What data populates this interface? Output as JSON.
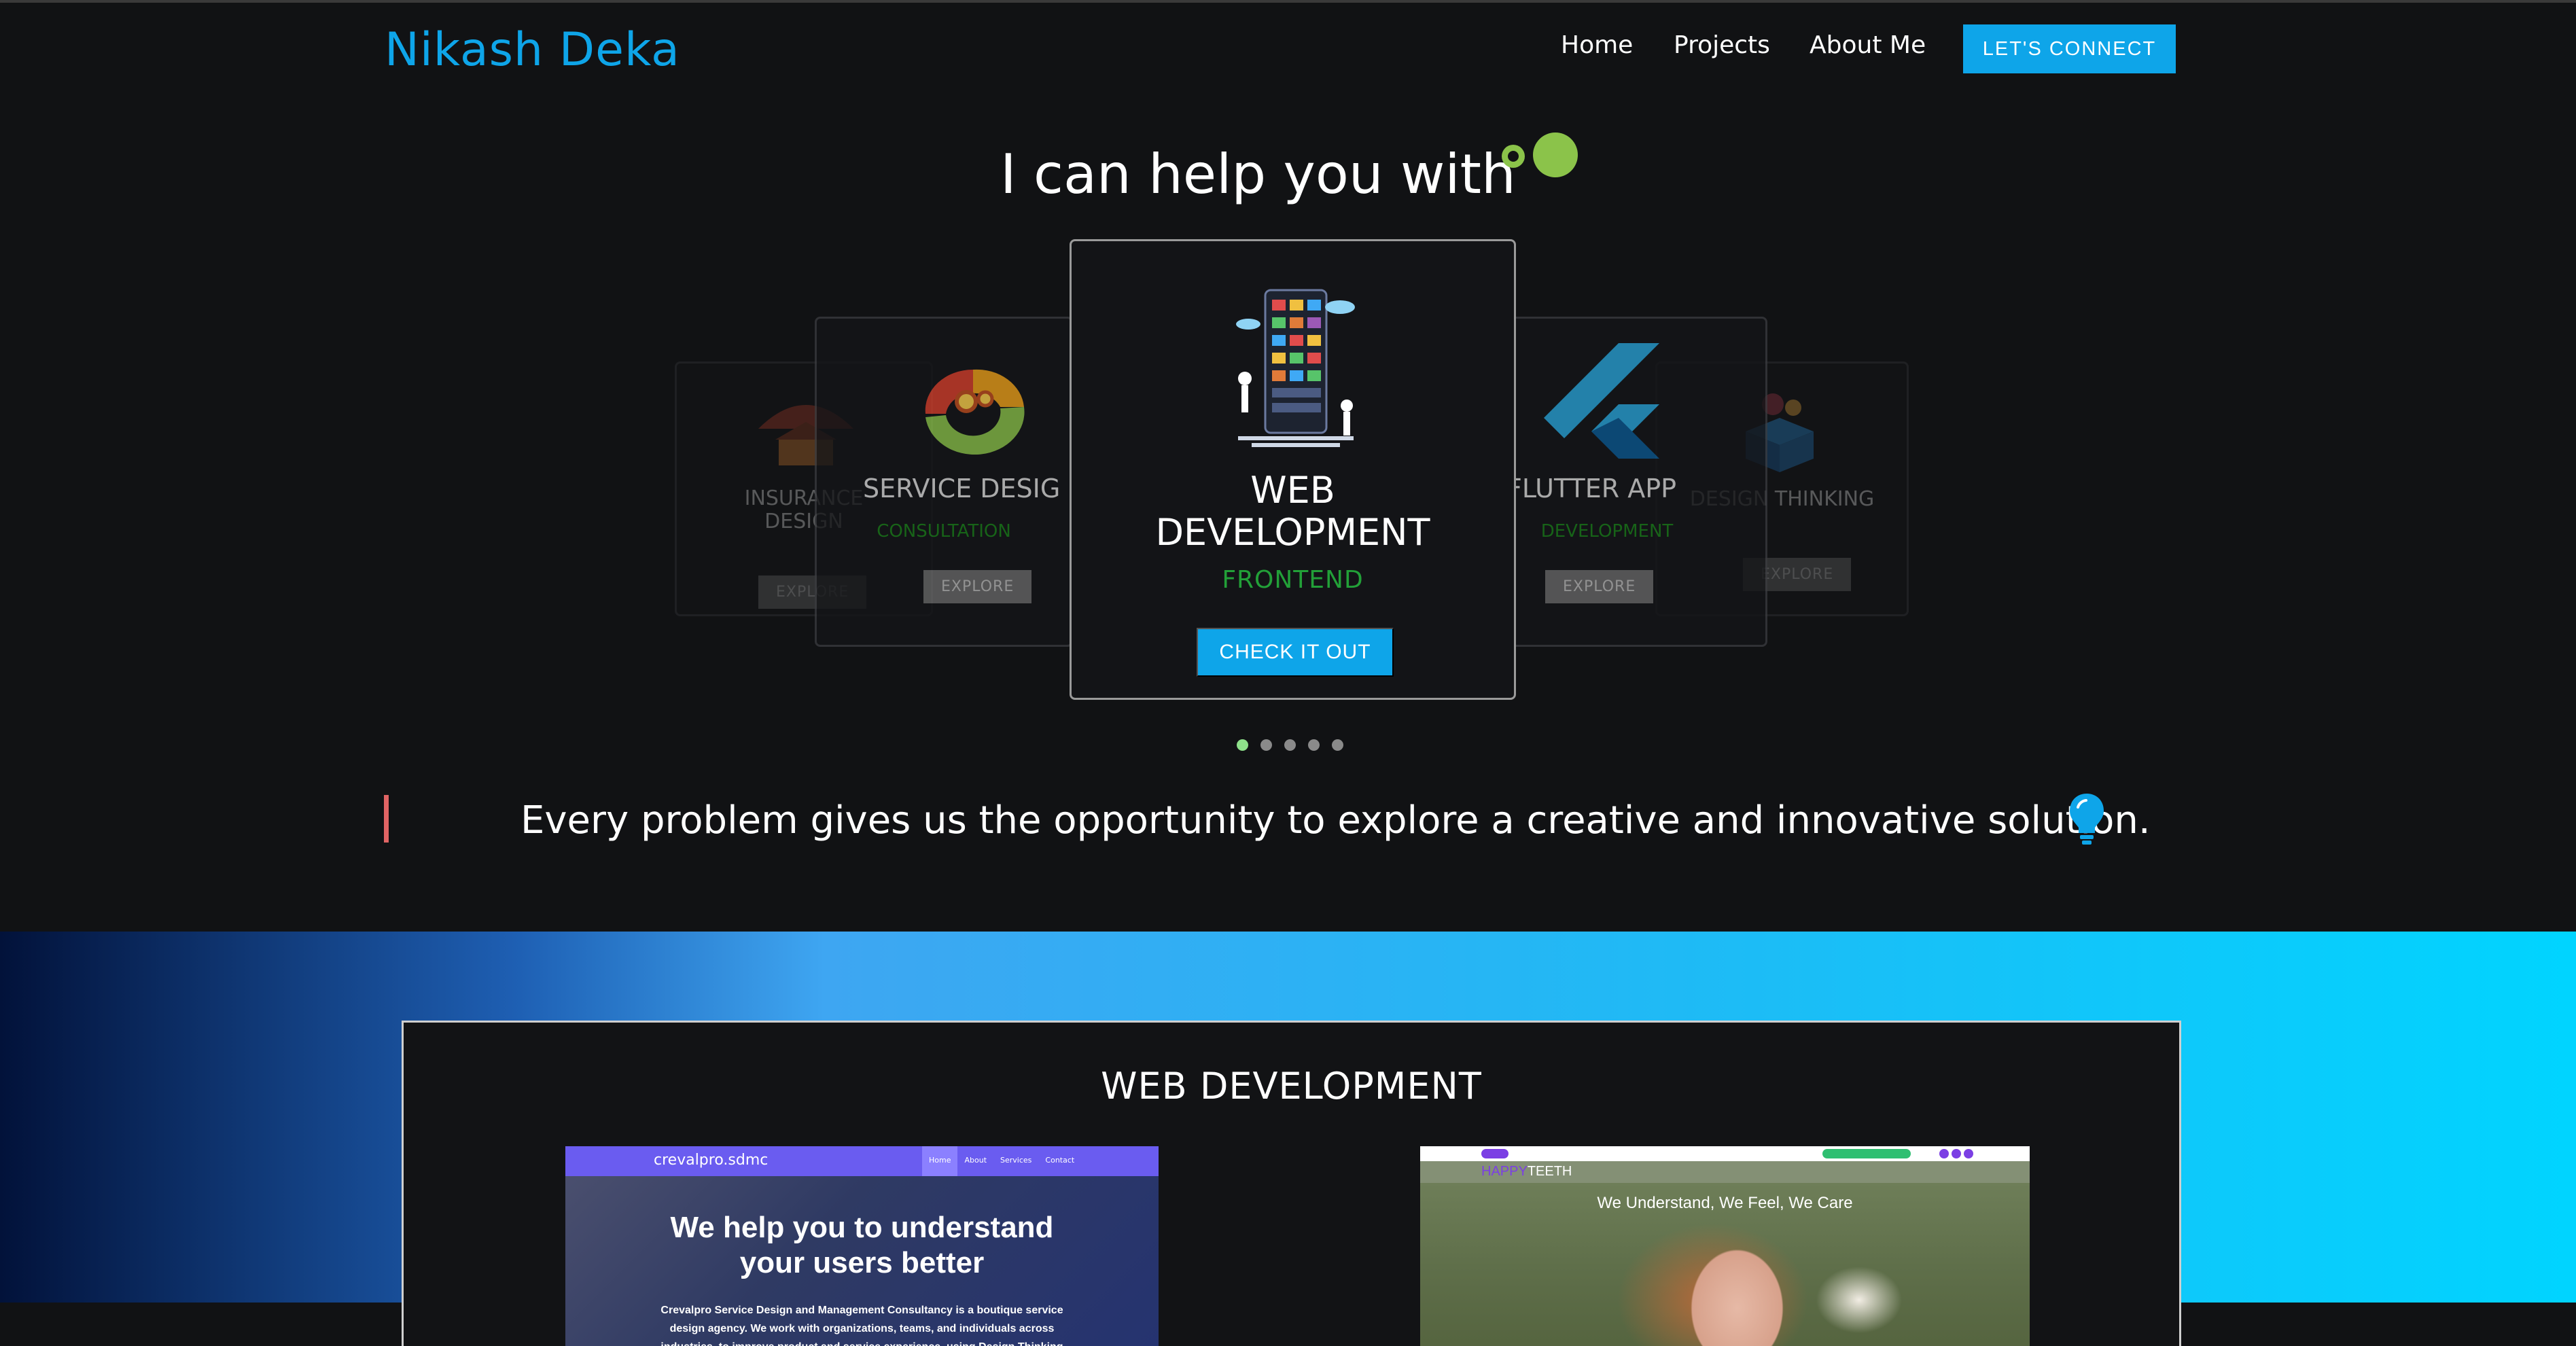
{
  "header": {
    "brand": "Nikash Deka",
    "nav": [
      "Home",
      "Projects",
      "About Me"
    ],
    "cta": "LET'S CONNECT"
  },
  "hero": {
    "heading": "I can help you with",
    "cards": {
      "insurance": {
        "title_line1": "INSURANCE",
        "title_line2": "DESIGN",
        "button": "EXPLORE"
      },
      "service": {
        "title": "SERVICE DESIG",
        "subtitle": "CONSULTATION",
        "button": "EXPLORE"
      },
      "main": {
        "title_line1": "WEB",
        "title_line2": "DEVELOPMENT",
        "subtitle": "FRONTEND",
        "button": "CHECK IT OUT"
      },
      "flutter": {
        "title": "FLUTTER APP",
        "subtitle": "DEVELOPMENT",
        "button": "EXPLORE"
      },
      "design": {
        "title": "DESIGN THINKING",
        "subtitle": "",
        "button": "EXPLORE"
      }
    },
    "pager": {
      "count": 5,
      "active_index": 0
    }
  },
  "quote": {
    "text": "Every problem gives us the opportunity to explore a creative and innovative solution."
  },
  "projects": {
    "section_title": "WEB DEVELOPMENT",
    "crevalpro": {
      "brand": "crevalpro.sdmc",
      "nav": [
        "Home",
        "About",
        "Services",
        "Contact"
      ],
      "heading_line1": "We help you to understand",
      "heading_line2": "your users better",
      "body": "Crevalpro Service Design and Management Consultancy is a boutique service design agency. We work with organizations, teams, and individuals across industries, to improve product and service experience, using Design Thinking framework and Service Design"
    },
    "happyteeth": {
      "logo_accent": "HAPPY",
      "logo_rest": "TEETH",
      "tagline": "We Understand, We Feel, We Care"
    }
  },
  "colors": {
    "accent": "#0ea5e9",
    "background": "#111214",
    "card_subtitle": "#22a038",
    "quote_bar": "#e06464",
    "pager_active": "#8ee08a"
  }
}
